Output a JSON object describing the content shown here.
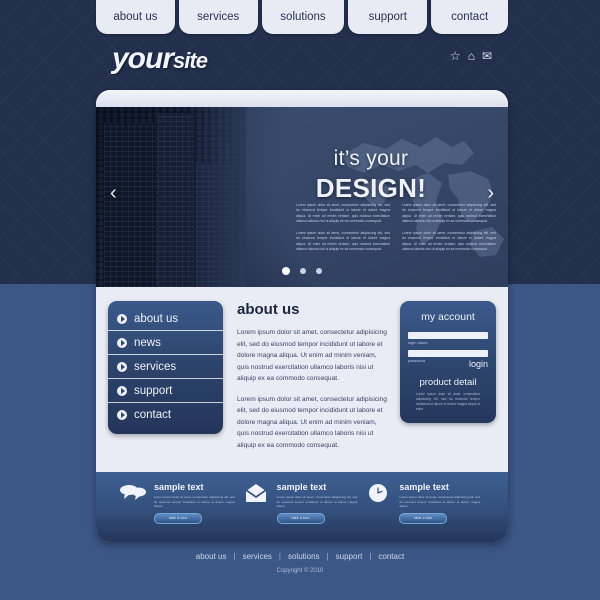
{
  "topnav": {
    "items": [
      {
        "label": "about us"
      },
      {
        "label": "services"
      },
      {
        "label": "solutions"
      },
      {
        "label": "support"
      },
      {
        "label": "contact"
      }
    ]
  },
  "header": {
    "logo_primary": "your",
    "logo_secondary": "site",
    "icons": [
      {
        "name": "star-icon",
        "glyph": "☆"
      },
      {
        "name": "home-icon",
        "glyph": "⌂"
      },
      {
        "name": "envelope-icon",
        "glyph": "✉"
      }
    ]
  },
  "hero": {
    "title_line1": "it’s your",
    "title_line2": "DESIGN!",
    "prev_glyph": "‹",
    "next_glyph": "›",
    "columns": [
      {
        "paragraphs": [
          "Lorem ipsum dolor sit amet, consectetur adipisicing elit, sed do eiusmod tempor incididunt ut labore et dolore magna aliqua. Ut enim ad minim veniam, quis nostrud exercitation ullamco laboris nisi ut aliquip ex ea commodo consequat.",
          "Lorem ipsum dolor sit amet, consectetur adipisicing elit, sed do eiusmod tempor incididunt ut labore et dolore magna aliqua. Ut enim ad minim veniam, quis nostrud exercitation ullamco laboris nisi ut aliquip ex ea commodo consequat."
        ]
      },
      {
        "paragraphs": [
          "Lorem ipsum dolor sit amet, consectetur adipisicing elit, sed do eiusmod tempor incididunt ut labore et dolore magna aliqua. Ut enim ad minim veniam, quis nostrud exercitation ullamco laboris nisi ut aliquip ex ea commodo consequat.",
          "Lorem ipsum dolor sit amet, consectetur adipisicing elit, sed do eiusmod tempor incididunt ut labore et dolore magna aliqua. Ut enim ad minim veniam, quis nostrud exercitation ullamco laboris nisi ut aliquip ex ea commodo consequat."
        ]
      }
    ],
    "slide_count": 3,
    "active_slide": 1
  },
  "sidebar": {
    "items": [
      {
        "label": "about us"
      },
      {
        "label": "news"
      },
      {
        "label": "services"
      },
      {
        "label": "support"
      },
      {
        "label": "contact"
      }
    ]
  },
  "about": {
    "heading": "about us",
    "paragraphs": [
      "Lorem ipsum dolor sit amet, consectetur adipisicing elit, sed do eiusmod tempor incididunt ut labore et dolore magna aliqua. Ut enim ad minim veniam, quis nostrud exercitation ullamco laboris nisi ut aliquip ex ea commodo consequat.",
      "Lorem ipsum dolor sit amet, consectetur adipisicing elit, sed do eiusmod tempor incididunt ut labore et dolore magna aliqua. Ut enim ad minim veniam, quis nostrud exercitation ullamco laboris nisi ut aliquip ex ea commodo consequat."
    ]
  },
  "account": {
    "heading": "my account",
    "login_label": "login name",
    "password_label": "password",
    "login_button": "login",
    "login_value": "",
    "password_value": "",
    "product_heading": "product detail",
    "product_text": "Lorem ipsum dolor sit amet, consectetur adipisicing elit, sed do eiusmod tempor incididunt ut labore et dolore magna aliqua ut enim."
  },
  "features": [
    {
      "icon": "speech-bubbles-icon",
      "heading": "sample text",
      "text": "Lorem ipsum dolor sit amet, consectetur adipisicing elit, sed do eiusmod tempor incididunt ut labore et dolore magna aliqua.",
      "button": "take a tour"
    },
    {
      "icon": "open-envelope-icon",
      "heading": "sample text",
      "text": "Lorem ipsum dolor sit amet, consectetur adipisicing elit, sed do eiusmod tempor incididunt ut labore et dolore magna aliqua.",
      "button": "take a tour"
    },
    {
      "icon": "clock-icon",
      "heading": "sample text",
      "text": "Lorem ipsum dolor sit amet, consectetur adipisicing elit, sed do eiusmod tempor incididunt ut labore et dolore magna aliqua.",
      "button": "take a tour"
    }
  ],
  "footer": {
    "links": [
      "about us",
      "services",
      "solutions",
      "support",
      "contact"
    ],
    "separator": "|",
    "copyright": "Copyright © 2010"
  },
  "colors": {
    "bg_dark": "#22304e",
    "bg_light": "#3b5786",
    "card": "#e9ebf5",
    "panel_blue": "#2d456c",
    "text_light": "#eef1fa"
  }
}
